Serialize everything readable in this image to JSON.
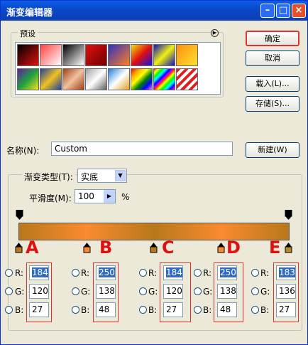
{
  "window": {
    "title": "渐变编辑器"
  },
  "presets": {
    "label": "预设"
  },
  "buttons": {
    "ok": "确定",
    "cancel": "取消",
    "load": "载入(L)...",
    "save": "存储(S)...",
    "new": "新建(W)"
  },
  "name": {
    "label": "名称(N):",
    "value": "Custom"
  },
  "gradient": {
    "type_label": "渐变类型(T):",
    "type_value": "实底",
    "smoothness_label": "平滑度(M):",
    "smoothness_value": "100",
    "smoothness_unit": "%"
  },
  "colors": {
    "orange": "#b8781b",
    "light": "#fa8a30"
  },
  "stops": [
    {
      "letter": "A",
      "r": "184",
      "g": "120",
      "b": "27"
    },
    {
      "letter": "B",
      "r": "250",
      "g": "138",
      "b": "48"
    },
    {
      "letter": "C",
      "r": "184",
      "g": "120",
      "b": "27"
    },
    {
      "letter": "D",
      "r": "250",
      "g": "138",
      "b": "48"
    },
    {
      "letter": "E",
      "r": "183",
      "g": "136",
      "b": "27"
    }
  ],
  "rgb_labels": {
    "r": "R:",
    "g": "G:",
    "b": "B:"
  }
}
